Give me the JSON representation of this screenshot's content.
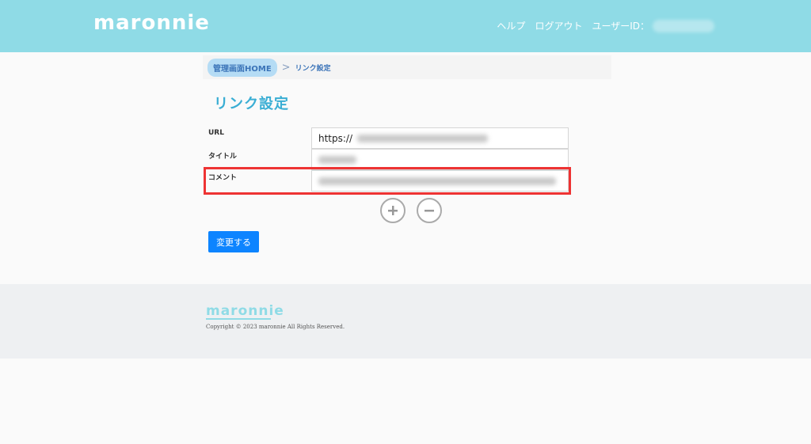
{
  "header": {
    "logo": "maronnie",
    "nav": {
      "help": "ヘルプ",
      "logout": "ログアウト",
      "user_id_label": "ユーザーID："
    }
  },
  "breadcrumb": {
    "home": "管理画面HOME",
    "separator": ">",
    "current": "リンク設定"
  },
  "page": {
    "title": "リンク設定"
  },
  "form": {
    "url_label": "URL",
    "url_value_prefix": "https://",
    "title_label": "タイトル",
    "comment_label": "コメント",
    "add_icon": "plus-circle-icon",
    "remove_icon": "minus-circle-icon",
    "submit_label": "変更する"
  },
  "footer": {
    "logo": "maronnie",
    "copyright": "Copyright © 2023 maronnie All Rights Reserved."
  },
  "colors": {
    "header_bg": "#8fdbe6",
    "title": "#3aaed4",
    "primary_button": "#0d84ff",
    "highlight": "#ee3333"
  }
}
